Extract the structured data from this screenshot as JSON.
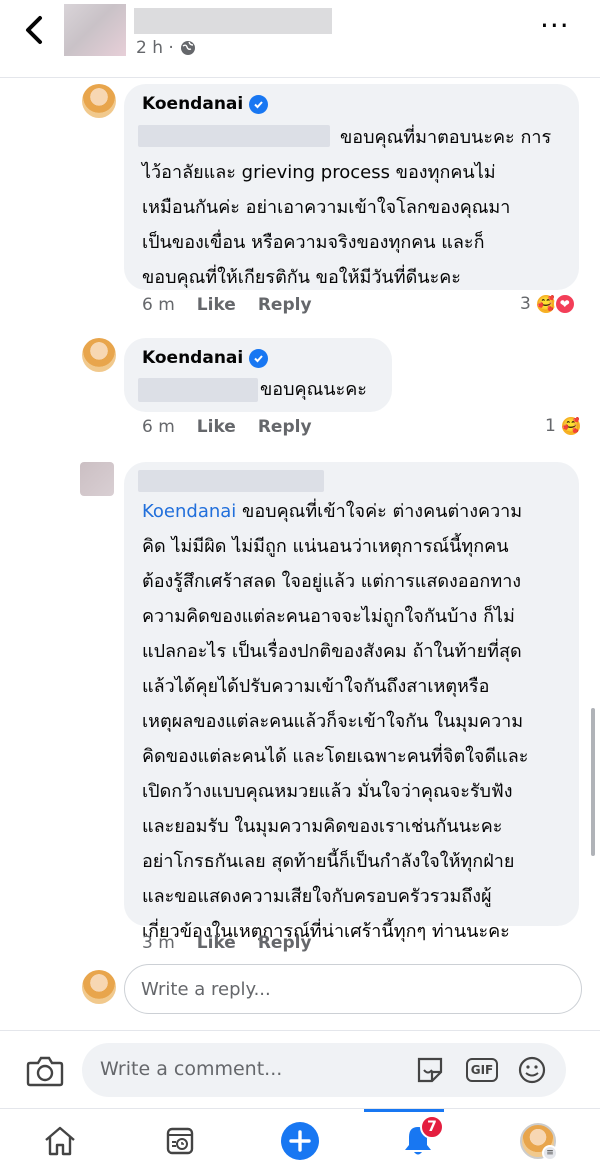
{
  "header": {
    "post_time": "2 h ·",
    "more_label": "···"
  },
  "comments": [
    {
      "name": "Koendanai",
      "text": "ขอบคุณที่มาตอบนะคะ การ\nไว้อาลัยและ grieving process ของทุกคนไม่\nเหมือนกันค่ะ อย่าเอาความเข้าใจโลกของคุณมา\nเป็นของเขื่อน หรือความจริงของทุกคน และก็\nขอบคุณที่ให้เกียรติกัน ขอให้มีวันที่ดีนะคะ",
      "time": "6 m",
      "like": "Like",
      "reply": "Reply",
      "reaction_count": "3"
    },
    {
      "name": "Koendanai",
      "text": "ขอบคุณนะคะ",
      "time": "6 m",
      "like": "Like",
      "reply": "Reply",
      "reaction_count": "1"
    },
    {
      "mention": "Koendanai",
      "text_first": " ขอบคุณที่เข้าใจค่ะ ต่างคนต่างความ",
      "text": "คิด ไม่มีผิด ไม่มีถูก แน่นอนว่าเหตุการณ์นี้ทุกคน\nต้องรู้สึกเศร้าสลด ใจอยู่แล้ว แต่การแสดงออกทาง\nความคิดของแต่ละคนอาจจะไม่ถูกใจกันบ้าง ก็ไม่\nแปลกอะไร เป็นเรื่องปกติของสังคม ถ้าในท้ายที่สุด\nแล้วได้คุยได้ปรับความเข้าใจกันถึงสาเหตุหรือ\nเหตุผลของแต่ละคนแล้วก็จะเข้าใจกัน ในมุมความ\nคิดของแต่ละคนได้ และโดยเฉพาะคนที่จิตใจดีและ\nเปิดกว้างแบบคุณหมวยแล้ว มั่นใจว่าคุณจะรับฟัง\nและยอมรับ ในมุมความคิดของเราเช่นกันนะคะ\nอย่าโกรธกันเลย สุดท้ายนี้ก็เป็นกำลังใจให้ทุกฝ่าย\nและขอแสดงความเสียใจกับครอบครัวรวมถึงผู้\nเกี่ยวข้องในเหตุการณ์ที่น่าเศร้านี้ทุกๆ ท่านนะคะ",
      "time": "3 m",
      "like": "Like",
      "reply": "Reply"
    }
  ],
  "reply_box": {
    "placeholder": "Write a reply..."
  },
  "composer": {
    "placeholder": "Write a comment...",
    "gif_label": "GIF"
  },
  "tabbar": {
    "notifications_badge": "7"
  },
  "colors": {
    "accent": "#1877f2",
    "badge": "#e41e3f",
    "bubble": "#f0f2f5",
    "mention": "#216fdb"
  }
}
